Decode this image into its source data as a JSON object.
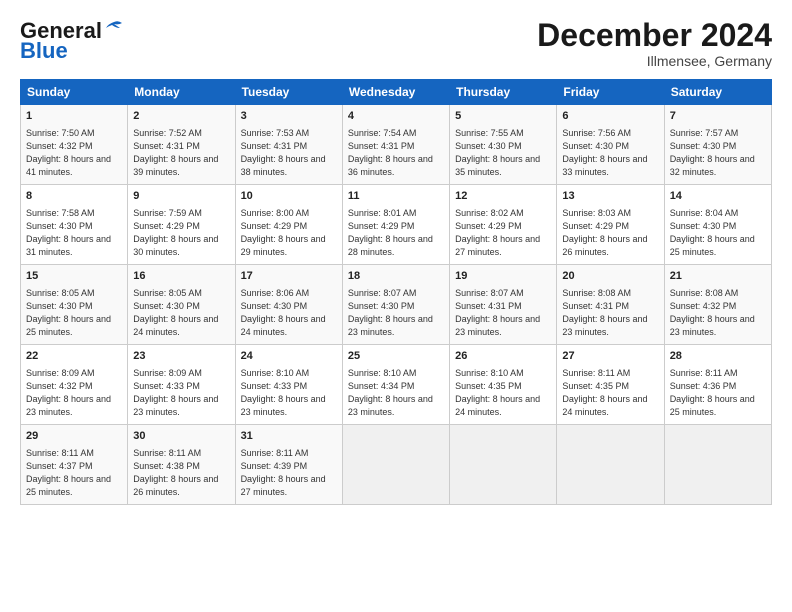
{
  "header": {
    "logo_general": "General",
    "logo_blue": "Blue",
    "title": "December 2024",
    "subtitle": "Illmensee, Germany"
  },
  "days_of_week": [
    "Sunday",
    "Monday",
    "Tuesday",
    "Wednesday",
    "Thursday",
    "Friday",
    "Saturday"
  ],
  "weeks": [
    [
      {
        "day": "1",
        "sunrise": "Sunrise: 7:50 AM",
        "sunset": "Sunset: 4:32 PM",
        "daylight": "Daylight: 8 hours and 41 minutes."
      },
      {
        "day": "2",
        "sunrise": "Sunrise: 7:52 AM",
        "sunset": "Sunset: 4:31 PM",
        "daylight": "Daylight: 8 hours and 39 minutes."
      },
      {
        "day": "3",
        "sunrise": "Sunrise: 7:53 AM",
        "sunset": "Sunset: 4:31 PM",
        "daylight": "Daylight: 8 hours and 38 minutes."
      },
      {
        "day": "4",
        "sunrise": "Sunrise: 7:54 AM",
        "sunset": "Sunset: 4:31 PM",
        "daylight": "Daylight: 8 hours and 36 minutes."
      },
      {
        "day": "5",
        "sunrise": "Sunrise: 7:55 AM",
        "sunset": "Sunset: 4:30 PM",
        "daylight": "Daylight: 8 hours and 35 minutes."
      },
      {
        "day": "6",
        "sunrise": "Sunrise: 7:56 AM",
        "sunset": "Sunset: 4:30 PM",
        "daylight": "Daylight: 8 hours and 33 minutes."
      },
      {
        "day": "7",
        "sunrise": "Sunrise: 7:57 AM",
        "sunset": "Sunset: 4:30 PM",
        "daylight": "Daylight: 8 hours and 32 minutes."
      }
    ],
    [
      {
        "day": "8",
        "sunrise": "Sunrise: 7:58 AM",
        "sunset": "Sunset: 4:30 PM",
        "daylight": "Daylight: 8 hours and 31 minutes."
      },
      {
        "day": "9",
        "sunrise": "Sunrise: 7:59 AM",
        "sunset": "Sunset: 4:29 PM",
        "daylight": "Daylight: 8 hours and 30 minutes."
      },
      {
        "day": "10",
        "sunrise": "Sunrise: 8:00 AM",
        "sunset": "Sunset: 4:29 PM",
        "daylight": "Daylight: 8 hours and 29 minutes."
      },
      {
        "day": "11",
        "sunrise": "Sunrise: 8:01 AM",
        "sunset": "Sunset: 4:29 PM",
        "daylight": "Daylight: 8 hours and 28 minutes."
      },
      {
        "day": "12",
        "sunrise": "Sunrise: 8:02 AM",
        "sunset": "Sunset: 4:29 PM",
        "daylight": "Daylight: 8 hours and 27 minutes."
      },
      {
        "day": "13",
        "sunrise": "Sunrise: 8:03 AM",
        "sunset": "Sunset: 4:29 PM",
        "daylight": "Daylight: 8 hours and 26 minutes."
      },
      {
        "day": "14",
        "sunrise": "Sunrise: 8:04 AM",
        "sunset": "Sunset: 4:30 PM",
        "daylight": "Daylight: 8 hours and 25 minutes."
      }
    ],
    [
      {
        "day": "15",
        "sunrise": "Sunrise: 8:05 AM",
        "sunset": "Sunset: 4:30 PM",
        "daylight": "Daylight: 8 hours and 25 minutes."
      },
      {
        "day": "16",
        "sunrise": "Sunrise: 8:05 AM",
        "sunset": "Sunset: 4:30 PM",
        "daylight": "Daylight: 8 hours and 24 minutes."
      },
      {
        "day": "17",
        "sunrise": "Sunrise: 8:06 AM",
        "sunset": "Sunset: 4:30 PM",
        "daylight": "Daylight: 8 hours and 24 minutes."
      },
      {
        "day": "18",
        "sunrise": "Sunrise: 8:07 AM",
        "sunset": "Sunset: 4:30 PM",
        "daylight": "Daylight: 8 hours and 23 minutes."
      },
      {
        "day": "19",
        "sunrise": "Sunrise: 8:07 AM",
        "sunset": "Sunset: 4:31 PM",
        "daylight": "Daylight: 8 hours and 23 minutes."
      },
      {
        "day": "20",
        "sunrise": "Sunrise: 8:08 AM",
        "sunset": "Sunset: 4:31 PM",
        "daylight": "Daylight: 8 hours and 23 minutes."
      },
      {
        "day": "21",
        "sunrise": "Sunrise: 8:08 AM",
        "sunset": "Sunset: 4:32 PM",
        "daylight": "Daylight: 8 hours and 23 minutes."
      }
    ],
    [
      {
        "day": "22",
        "sunrise": "Sunrise: 8:09 AM",
        "sunset": "Sunset: 4:32 PM",
        "daylight": "Daylight: 8 hours and 23 minutes."
      },
      {
        "day": "23",
        "sunrise": "Sunrise: 8:09 AM",
        "sunset": "Sunset: 4:33 PM",
        "daylight": "Daylight: 8 hours and 23 minutes."
      },
      {
        "day": "24",
        "sunrise": "Sunrise: 8:10 AM",
        "sunset": "Sunset: 4:33 PM",
        "daylight": "Daylight: 8 hours and 23 minutes."
      },
      {
        "day": "25",
        "sunrise": "Sunrise: 8:10 AM",
        "sunset": "Sunset: 4:34 PM",
        "daylight": "Daylight: 8 hours and 23 minutes."
      },
      {
        "day": "26",
        "sunrise": "Sunrise: 8:10 AM",
        "sunset": "Sunset: 4:35 PM",
        "daylight": "Daylight: 8 hours and 24 minutes."
      },
      {
        "day": "27",
        "sunrise": "Sunrise: 8:11 AM",
        "sunset": "Sunset: 4:35 PM",
        "daylight": "Daylight: 8 hours and 24 minutes."
      },
      {
        "day": "28",
        "sunrise": "Sunrise: 8:11 AM",
        "sunset": "Sunset: 4:36 PM",
        "daylight": "Daylight: 8 hours and 25 minutes."
      }
    ],
    [
      {
        "day": "29",
        "sunrise": "Sunrise: 8:11 AM",
        "sunset": "Sunset: 4:37 PM",
        "daylight": "Daylight: 8 hours and 25 minutes."
      },
      {
        "day": "30",
        "sunrise": "Sunrise: 8:11 AM",
        "sunset": "Sunset: 4:38 PM",
        "daylight": "Daylight: 8 hours and 26 minutes."
      },
      {
        "day": "31",
        "sunrise": "Sunrise: 8:11 AM",
        "sunset": "Sunset: 4:39 PM",
        "daylight": "Daylight: 8 hours and 27 minutes."
      },
      null,
      null,
      null,
      null
    ]
  ]
}
